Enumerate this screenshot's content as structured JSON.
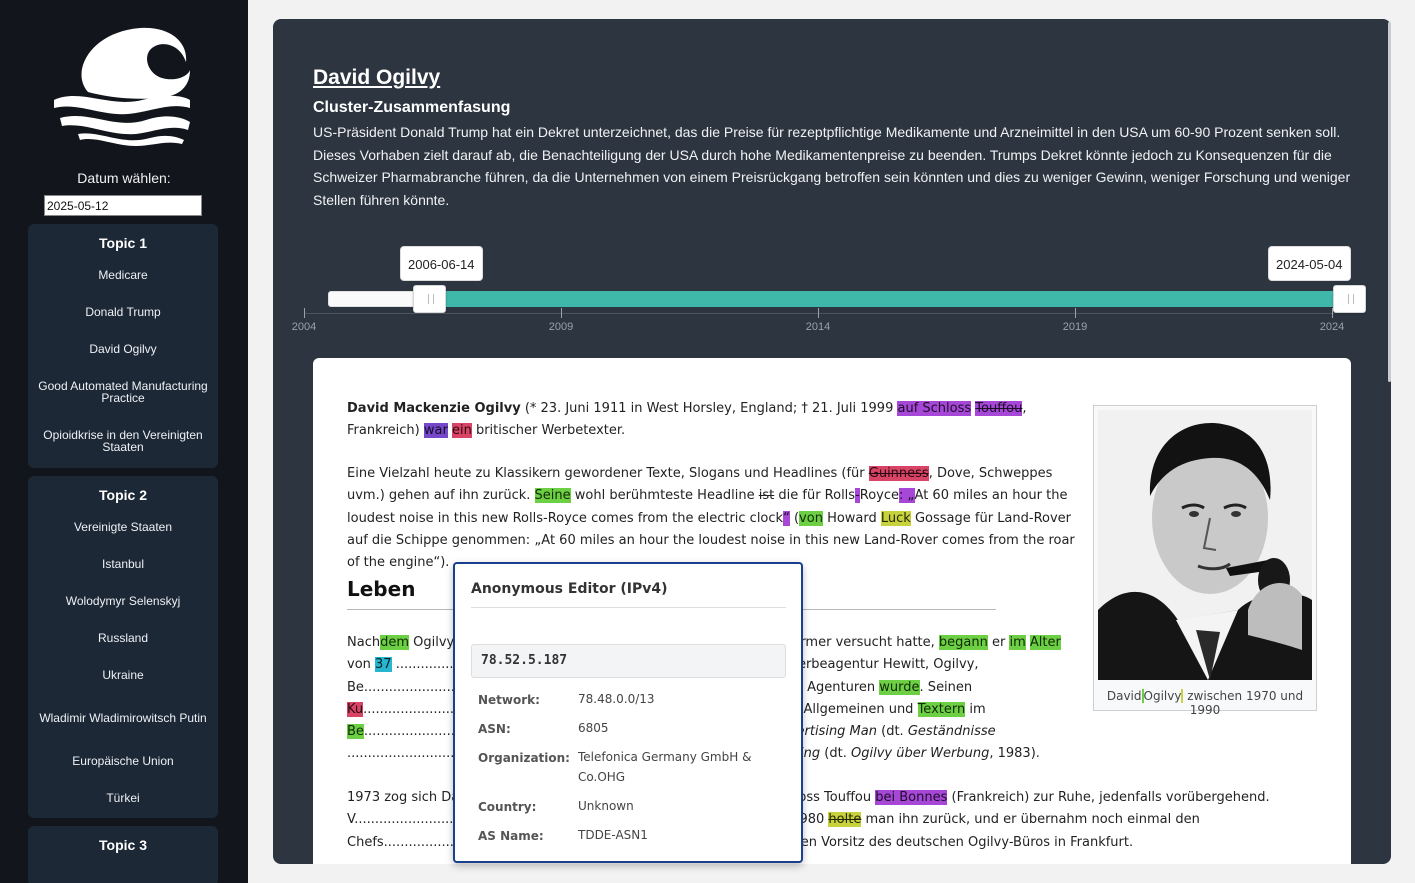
{
  "sidebar": {
    "date_label": "Datum wählen:",
    "date_value": "2025-05-12",
    "topics": [
      {
        "title": "Topic 1",
        "items": [
          "Medicare",
          "Donald Trump",
          "David Ogilvy",
          "Good Automated Manufacturing Practice",
          "Opioidkrise in den Vereinigten Staaten"
        ]
      },
      {
        "title": "Topic 2",
        "items": [
          "Vereinigte Staaten",
          "Istanbul",
          "Wolodymyr Selenskyj",
          "Russland",
          "Ukraine",
          "Wladimir Wladimirowitsch Putin",
          "Europäische Union",
          "Türkei"
        ]
      },
      {
        "title": "Topic 3",
        "items": []
      }
    ]
  },
  "main": {
    "title": "David Ogilvy",
    "summary_heading": "Cluster-Zusammenfasung",
    "summary_text": "US-Präsident Donald Trump hat ein Dekret unterzeichnet, das die Preise für rezeptpflichtige Medikamente und Arzneimittel in den USA um 60-90 Prozent senken soll. Dieses Vorhaben zielt darauf ab, die Benachteiligung der USA durch hohe Medikamentenpreise zu beenden. Trumps Dekret könnte jedoch zu Konsequenzen für die Schweizer Pharmabranche führen, da die Unternehmen von einem Preisrückgang betroffen sein könnten und dies zu weniger Gewinn, weniger Forschung und weniger Stellen führen könnte.",
    "slider": {
      "start_label": "2006-06-14",
      "end_label": "2024-05-04",
      "axis_min": 2004,
      "axis_max": 2024,
      "ticks": [
        "2004",
        "2009",
        "2014",
        "2019",
        "2024"
      ],
      "range_color": "#3fb7a9"
    }
  },
  "article": {
    "leben_heading": "Leben",
    "caption_parts": [
      "David",
      "Ogilvy",
      " zwischen 1970 und 1990"
    ]
  },
  "popup": {
    "title": "Anonymous Editor (IPv4)",
    "ip": "78.52.5.187",
    "rows": [
      {
        "key": "Network:",
        "value": "78.48.0.0/13"
      },
      {
        "key": "ASN:",
        "value": "6805"
      },
      {
        "key": "Organization:",
        "value": "Telefonica Germany GmbH & Co.OHG"
      },
      {
        "key": "Country:",
        "value": "Unknown"
      },
      {
        "key": "AS Name:",
        "value": "TDDE-ASN1"
      }
    ]
  },
  "colors": {
    "sidebar_bg": "#12161c",
    "card_bg": "#1c2836",
    "panel_bg": "#2c3540",
    "highlight_green": "#6ccf44",
    "highlight_purple": "#a747d8",
    "highlight_red": "#d94466",
    "highlight_yellow": "#c8d23c",
    "highlight_cyan": "#28b5cf"
  }
}
